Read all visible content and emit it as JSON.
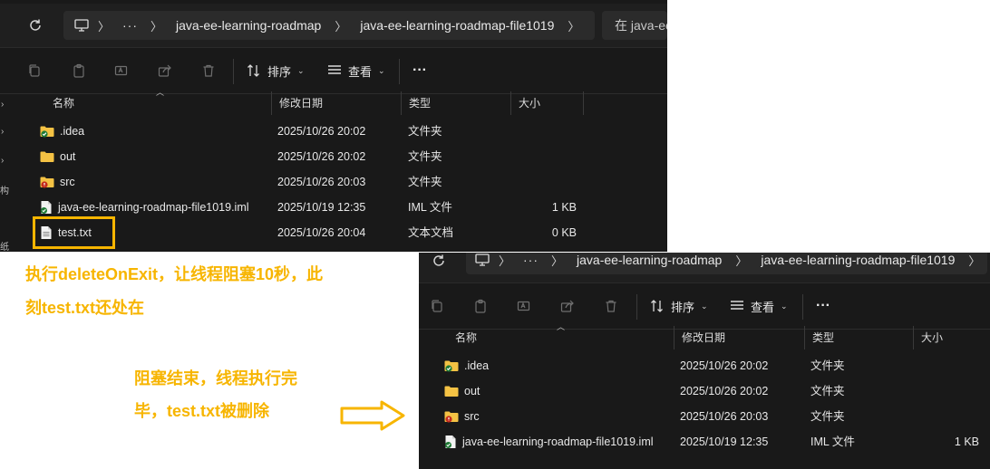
{
  "top_window": {
    "breadcrumb": [
      "java-ee-learning-roadmap",
      "java-ee-learning-roadmap-file1019"
    ],
    "search_placeholder": "在 java-ee",
    "toolbar": {
      "sort_label": "排序",
      "view_label": "查看",
      "more_label": "···"
    },
    "columns": {
      "name": "名称",
      "date": "修改日期",
      "type": "类型",
      "size": "大小"
    },
    "rows": [
      {
        "icon": "folder-check-icon",
        "name": ".idea",
        "date": "2025/10/26 20:02",
        "type": "文件夹",
        "size": ""
      },
      {
        "icon": "folder-icon",
        "name": "out",
        "date": "2025/10/26 20:02",
        "type": "文件夹",
        "size": ""
      },
      {
        "icon": "folder-warning-icon",
        "name": "src",
        "date": "2025/10/26 20:03",
        "type": "文件夹",
        "size": ""
      },
      {
        "icon": "iml-file-icon",
        "name": "java-ee-learning-roadmap-file1019.iml",
        "date": "2025/10/19 12:35",
        "type": "IML 文件",
        "size": "1 KB"
      },
      {
        "icon": "text-file-icon",
        "name": "test.txt",
        "date": "2025/10/26 20:04",
        "type": "文本文档",
        "size": "0 KB"
      }
    ],
    "left_strip": [
      "构",
      "纸"
    ]
  },
  "bottom_window": {
    "breadcrumb": [
      "java-ee-learning-roadmap",
      "java-ee-learning-roadmap-file1019"
    ],
    "toolbar": {
      "sort_label": "排序",
      "view_label": "查看",
      "more_label": "···"
    },
    "columns": {
      "name": "名称",
      "date": "修改日期",
      "type": "类型",
      "size": "大小"
    },
    "rows": [
      {
        "icon": "folder-check-icon",
        "name": ".idea",
        "date": "2025/10/26 20:02",
        "type": "文件夹",
        "size": ""
      },
      {
        "icon": "folder-icon",
        "name": "out",
        "date": "2025/10/26 20:02",
        "type": "文件夹",
        "size": ""
      },
      {
        "icon": "folder-warning-icon",
        "name": "src",
        "date": "2025/10/26 20:03",
        "type": "文件夹",
        "size": ""
      },
      {
        "icon": "iml-file-icon",
        "name": "java-ee-learning-roadmap-file1019.iml",
        "date": "2025/10/19 12:35",
        "type": "IML 文件",
        "size": "1 KB"
      }
    ]
  },
  "annotations": {
    "first_line1": "执行deleteOnExit，让线程阻塞10秒，此",
    "first_line2": "刻test.txt还处在",
    "second_line1": "阻塞结束，线程执行完",
    "second_line2": "毕，test.txt被删除"
  },
  "colors": {
    "accent": "#f7b500",
    "explorer_bg": "#191919",
    "folder": "#f4c244"
  }
}
